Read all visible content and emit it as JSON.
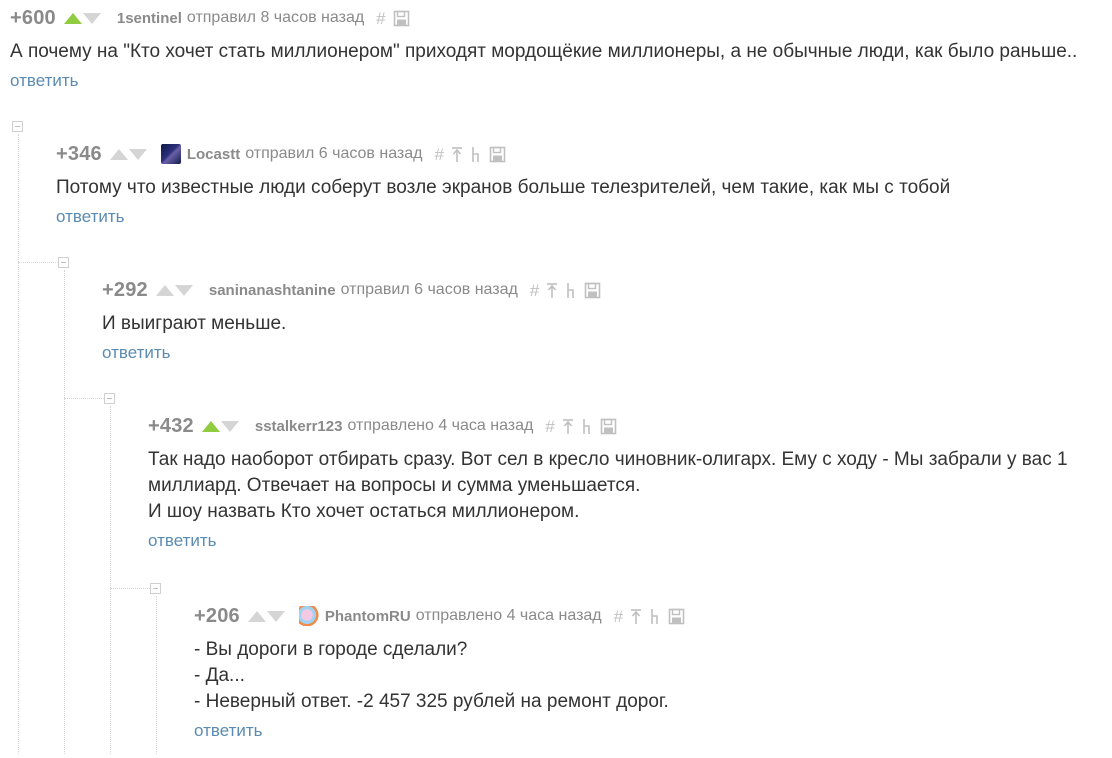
{
  "colors": {
    "text": "#333333",
    "meta": "#8a8a8a",
    "link": "#5b8bb3",
    "upvote_active": "#8fcc3f",
    "vote_idle": "#d5d5d5"
  },
  "comments": [
    {
      "rating": "+600",
      "upvoted": true,
      "author": "1sentinel",
      "time": "отправил 8 часов назад",
      "text": "А почему на \"Кто хочет стать миллионером\" приходят мордощёкие миллионеры, а не обычные люди, как было раньше..",
      "reply": "ответить"
    },
    {
      "rating": "+346",
      "upvoted": false,
      "author": "Locastt",
      "time": "отправил 6 часов назад",
      "text": "Потому что известные люди соберут возле экранов больше телезрителей, чем такие, как мы с тобой",
      "reply": "ответить"
    },
    {
      "rating": "+292",
      "upvoted": false,
      "author": "saninanashtanine",
      "time": "отправил 6 часов назад",
      "text": "И выиграют меньше.",
      "reply": "ответить"
    },
    {
      "rating": "+432",
      "upvoted": true,
      "author": "sstalkerr123",
      "time": "отправлено 4 часа назад",
      "text": "Так надо наоборот отбирать сразу. Вот сел в кресло чиновник-олигарх. Ему с ходу - Мы забрали у вас 1\nмиллиард. Отвечает на вопросы и сумма уменьшается.\nИ шоу назвать Кто хочет остаться миллионером.",
      "reply": "ответить"
    },
    {
      "rating": "+206",
      "upvoted": false,
      "author": "PhantomRU",
      "time": "отправлено 4 часа назад",
      "text": "- Вы дороги в городе сделали?\n- Да...\n- Неверный ответ. -2 457 325 рублей на ремонт дорог.",
      "reply": "ответить"
    }
  ]
}
